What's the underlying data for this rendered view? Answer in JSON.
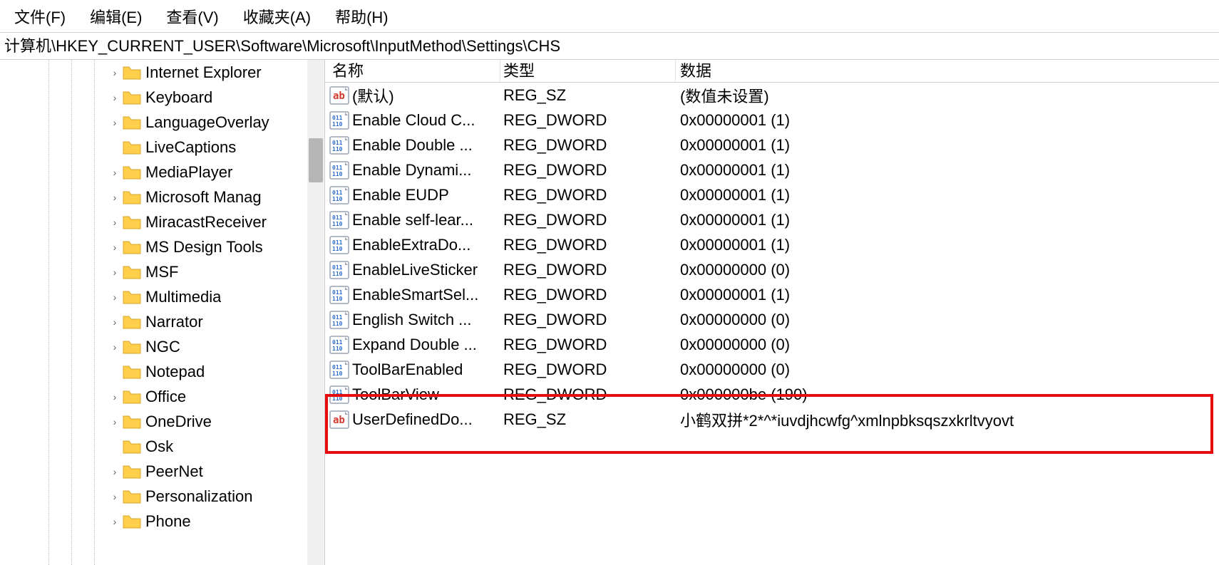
{
  "menu": {
    "file": "文件(F)",
    "edit": "编辑(E)",
    "view": "查看(V)",
    "fav": "收藏夹(A)",
    "help": "帮助(H)"
  },
  "address": "计算机\\HKEY_CURRENT_USER\\Software\\Microsoft\\InputMethod\\Settings\\CHS",
  "tree": [
    {
      "label": "Internet Explorer",
      "expandable": true
    },
    {
      "label": "Keyboard",
      "expandable": true
    },
    {
      "label": "LanguageOverlay",
      "expandable": true
    },
    {
      "label": "LiveCaptions",
      "expandable": false
    },
    {
      "label": "MediaPlayer",
      "expandable": true
    },
    {
      "label": "Microsoft Manag",
      "expandable": true
    },
    {
      "label": "MiracastReceiver",
      "expandable": true
    },
    {
      "label": "MS Design Tools",
      "expandable": true
    },
    {
      "label": "MSF",
      "expandable": true
    },
    {
      "label": "Multimedia",
      "expandable": true
    },
    {
      "label": "Narrator",
      "expandable": true
    },
    {
      "label": "NGC",
      "expandable": true
    },
    {
      "label": "Notepad",
      "expandable": false
    },
    {
      "label": "Office",
      "expandable": true
    },
    {
      "label": "OneDrive",
      "expandable": true
    },
    {
      "label": "Osk",
      "expandable": false
    },
    {
      "label": "PeerNet",
      "expandable": true
    },
    {
      "label": "Personalization",
      "expandable": true
    },
    {
      "label": "Phone",
      "expandable": true
    }
  ],
  "columns": {
    "name": "名称",
    "type": "类型",
    "data": "数据"
  },
  "values": [
    {
      "icon": "sz",
      "name": "(默认)",
      "type": "REG_SZ",
      "data": "(数值未设置)"
    },
    {
      "icon": "dword",
      "name": "Enable Cloud C...",
      "type": "REG_DWORD",
      "data": "0x00000001 (1)"
    },
    {
      "icon": "dword",
      "name": "Enable Double ...",
      "type": "REG_DWORD",
      "data": "0x00000001 (1)"
    },
    {
      "icon": "dword",
      "name": "Enable Dynami...",
      "type": "REG_DWORD",
      "data": "0x00000001 (1)"
    },
    {
      "icon": "dword",
      "name": "Enable EUDP",
      "type": "REG_DWORD",
      "data": "0x00000001 (1)"
    },
    {
      "icon": "dword",
      "name": "Enable self-lear...",
      "type": "REG_DWORD",
      "data": "0x00000001 (1)"
    },
    {
      "icon": "dword",
      "name": "EnableExtraDo...",
      "type": "REG_DWORD",
      "data": "0x00000001 (1)"
    },
    {
      "icon": "dword",
      "name": "EnableLiveSticker",
      "type": "REG_DWORD",
      "data": "0x00000000 (0)"
    },
    {
      "icon": "dword",
      "name": "EnableSmartSel...",
      "type": "REG_DWORD",
      "data": "0x00000001 (1)"
    },
    {
      "icon": "dword",
      "name": "English Switch ...",
      "type": "REG_DWORD",
      "data": "0x00000000 (0)"
    },
    {
      "icon": "dword",
      "name": "Expand Double ...",
      "type": "REG_DWORD",
      "data": "0x00000000 (0)"
    },
    {
      "icon": "dword",
      "name": "ToolBarEnabled",
      "type": "REG_DWORD",
      "data": "0x00000000 (0)"
    },
    {
      "icon": "dword",
      "name": "ToolBarView",
      "type": "REG_DWORD",
      "data": "0x000000be (190)"
    },
    {
      "icon": "sz",
      "name": "UserDefinedDo...",
      "type": "REG_SZ",
      "data": "小鹤双拼*2*^*iuvdjhcwfg^xmlnpbksqszxkrltvyovt"
    }
  ]
}
